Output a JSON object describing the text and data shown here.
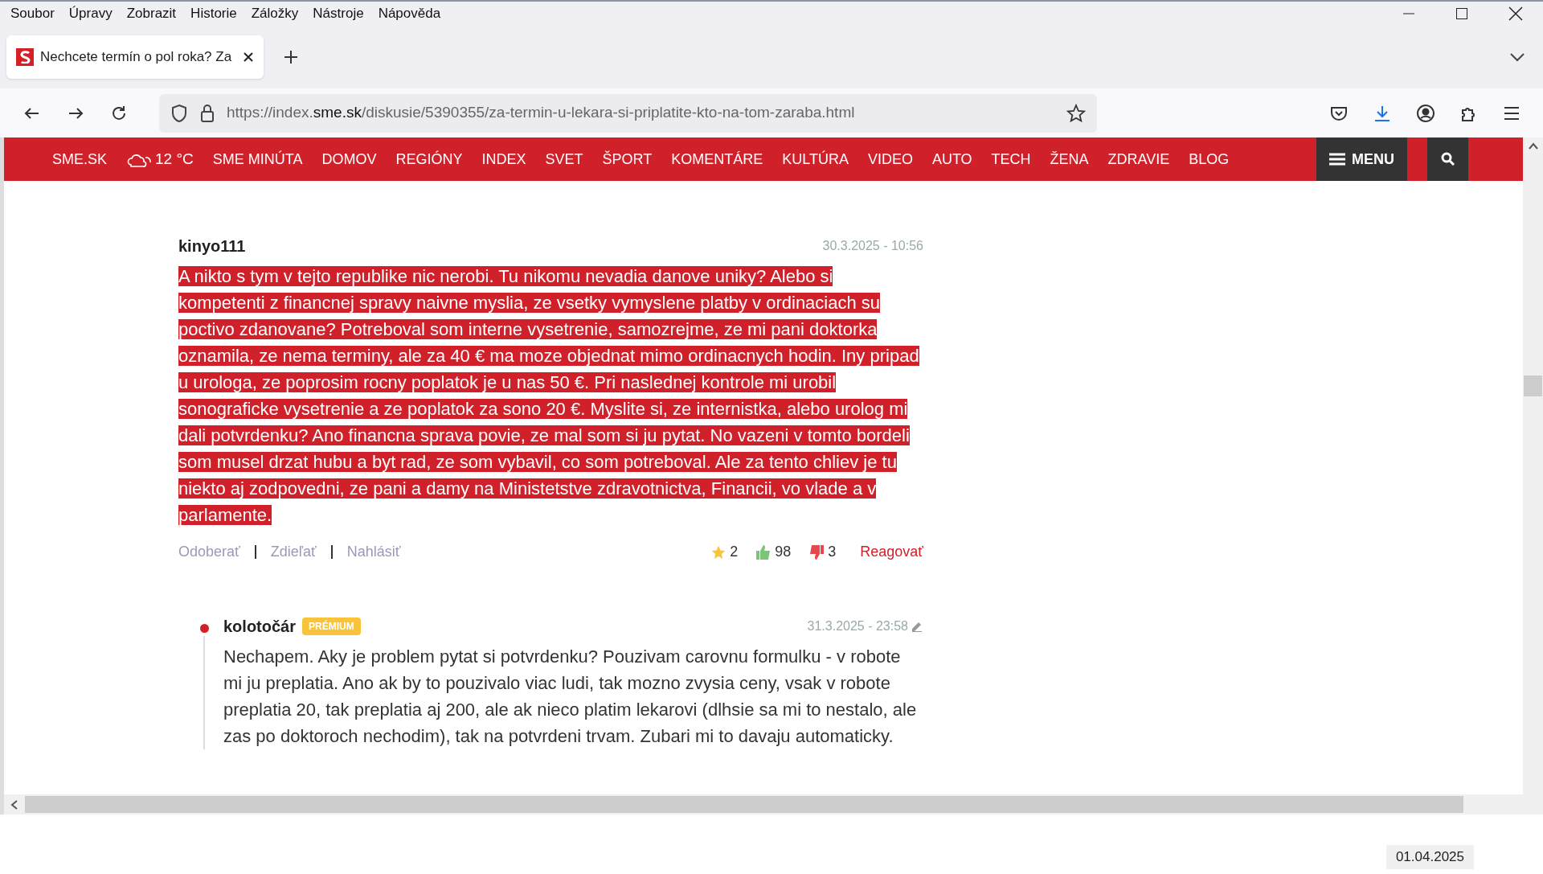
{
  "menu_bar": [
    {
      "label": "Soubor"
    },
    {
      "label": "Úpravy"
    },
    {
      "label": "Zobrazit"
    },
    {
      "label": "Historie"
    },
    {
      "label": "Záložky"
    },
    {
      "label": "Nástroje"
    },
    {
      "label": "Nápověda"
    }
  ],
  "tabs": [
    {
      "title": "Nechcete termín o pol roka? Za",
      "selected": true
    }
  ],
  "address_bar": {
    "url_prefix": "https://index.",
    "url_domain": "sme.sk",
    "url_path": "/diskusie/5390355/za-termin-u-lekara-si-priplatite-kto-na-tom-zaraba.html"
  },
  "site_nav": {
    "items": [
      "SME.SK",
      "SME MINÚTA",
      "DOMOV",
      "REGIÓNY",
      "INDEX",
      "SVET",
      "ŠPORT",
      "KOMENTÁRE",
      "KULTÚRA",
      "VIDEO",
      "AUTO",
      "TECH",
      "ŽENA",
      "ZDRAVIE",
      "BLOG"
    ],
    "weather": "12 °C",
    "menu": "MENU"
  },
  "comments": [
    {
      "author": "kinyo111",
      "date": "30.3.2025 - 10:56",
      "highlighted": true,
      "text": "A nikto s tym v tejto republike nic nerobi. Tu nikomu nevadia danove uniky? Alebo si kompetenti z financnej spravy naivne myslia, ze vsetky vymyslene platby v ordinaciach su poctivo zdanovane? Potreboval som interne vysetrenie, samozrejme, ze mi pani doktorka oznamila, ze nema terminy, ale za 40 € ma moze objednat mimo ordinacnych hodin. Iny pripad u urologa, ze poprosim rocny poplatok je u nas 50 €. Pri naslednej kontrole mi urobil sonograficke vysetrenie a ze poplatok za sono 20 €. Myslite si, ze internistka, alebo urolog mi dali potvrdenku? Ano financna sprava povie, ze mal som si ju pytat. No vazeni v tomto bordeli som musel drzat hubu a byt rad, ze som vybavil, co som potreboval. Ale za tento chliev je tu niekto aj zodpovedni, ze pani a damy na Ministetstve zdravotnictva, Financii, vo vlade a v parlamente.",
      "actions": [
        "Odoberať",
        "Zdieľať",
        "Nahlásiť"
      ],
      "stars": "2",
      "likes": "98",
      "dislikes": "3",
      "reply": "Reagovať",
      "replies": [
        {
          "author": "kolotočár",
          "badge": "PRÉMIUM",
          "date": "31.3.2025 - 23:58",
          "highlighted": false,
          "text": "Nechapem. Aky je problem pytat si potvrdenku? Pouzivam carovnu formulku - v robote mi ju preplatia. Ano ak by to pouzivalo viac ludi, tak mozno zvysia ceny, vsak v robote preplatia 20, tak preplatia aj 200, ale ak nieco platim lekarovi (dlhsie sa mi to nestalo, ale zas po doktoroch nechodim), tak na potvrdeni trvam. Zubari mi to davaju automaticky."
        }
      ]
    }
  ],
  "footer_date": "01.04.2025"
}
